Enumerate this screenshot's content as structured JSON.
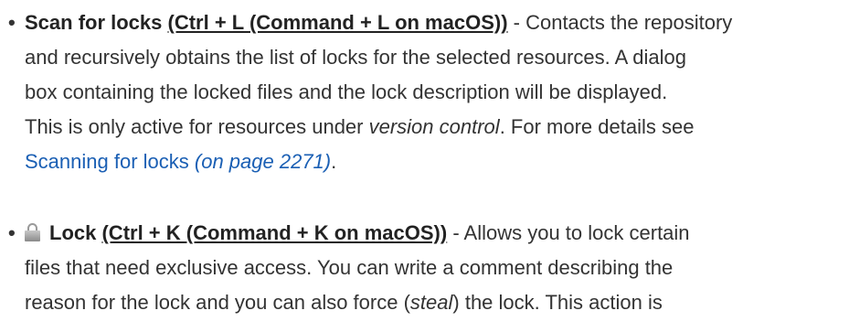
{
  "bullet_char": "•",
  "items": [
    {
      "name": "Scan for locks",
      "shortcut": "(Ctrl + L (Command + L on macOS))",
      "line1_rest": " - Contacts the repository",
      "line2": "and recursively obtains the list of locks for the selected resources. A dialog",
      "line3": "box containing the locked files and the lock description will be displayed.",
      "line4_pre": "This is only active for resources under ",
      "line4_em": "version control",
      "line4_post": ". For more details see",
      "link_text": "Scanning for locks",
      "link_page_ref": "(on page 2271)",
      "line5_post": "."
    },
    {
      "icon": "lock-icon",
      "name": "Lock",
      "shortcut": "(Ctrl + K (Command + K on macOS))",
      "line1_rest": " - Allows you to lock certain",
      "line2": "files that need exclusive access. You can write a comment describing the",
      "line3_pre": "reason for the lock and you can also force (",
      "line3_em": "steal",
      "line3_post": ") the lock. This action is"
    }
  ]
}
